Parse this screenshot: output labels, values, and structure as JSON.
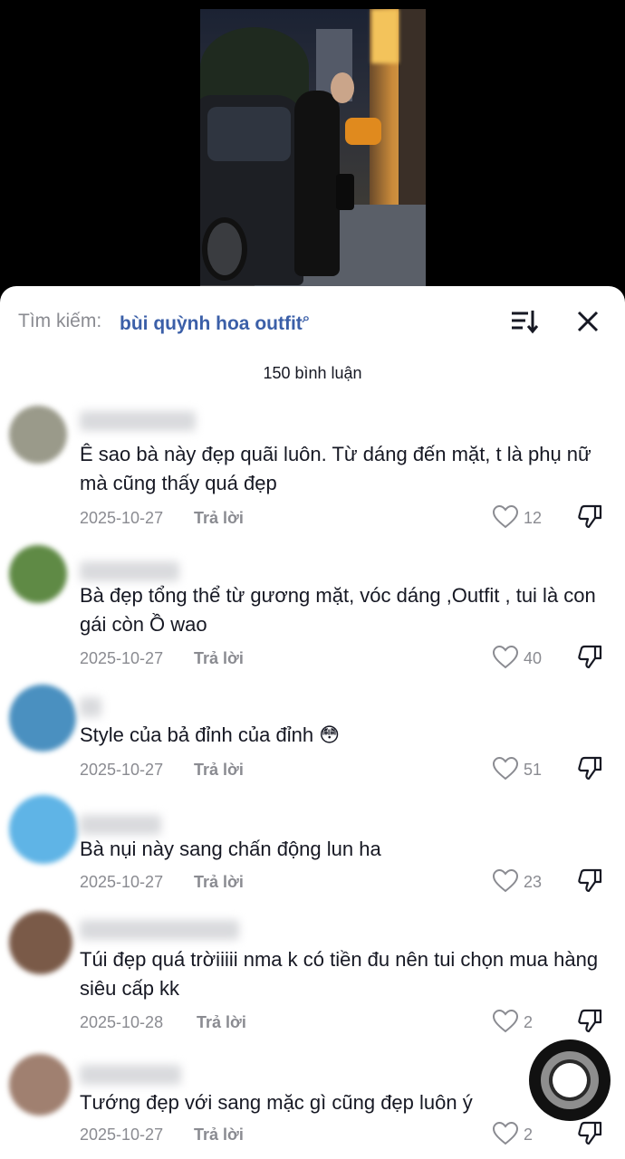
{
  "search": {
    "label": "Tìm kiếm:",
    "query": "bùi quỳnh hoa outfit",
    "icon": "search-icon"
  },
  "header": {
    "sort_icon": "sort-icon",
    "close_icon": "close-icon"
  },
  "comments_count": "150 bình luận",
  "reply_label": "Trả lời",
  "comments": [
    {
      "text": "Ê sao bà này đẹp quãi luôn. Từ dáng đến mặt, t là phụ nữ mà cũng thấy quá đẹp",
      "date": "2025-10-27",
      "likes": "12",
      "avatar_color": "#9a9a8a"
    },
    {
      "text": "Bà đẹp tổng thể từ gương mặt, vóc dáng ,Outfit , tui là con gái còn Ồ wao",
      "date": "2025-10-27",
      "likes": "40",
      "avatar_color": "#5f8a45"
    },
    {
      "text": "Style của bả đỉnh của đỉnh 😳",
      "date": "2025-10-27",
      "likes": "51",
      "avatar_color": "#4a90c0"
    },
    {
      "text": "Bà nụi này sang chấn động lun ha",
      "date": "2025-10-27",
      "likes": "23",
      "avatar_color": "#5fb4e6"
    },
    {
      "text": "Túi đẹp quá trờiiiii nma k có tiền đu nên tui chọn mua hàng siêu cấp kk",
      "date": "2025-10-28",
      "likes": "2",
      "avatar_color": "#7a5a48"
    },
    {
      "text": "Tướng đẹp với sang mặc gì cũng đẹp luôn ý",
      "date": "2025-10-27",
      "likes": "2",
      "avatar_color": "#a08070"
    }
  ]
}
